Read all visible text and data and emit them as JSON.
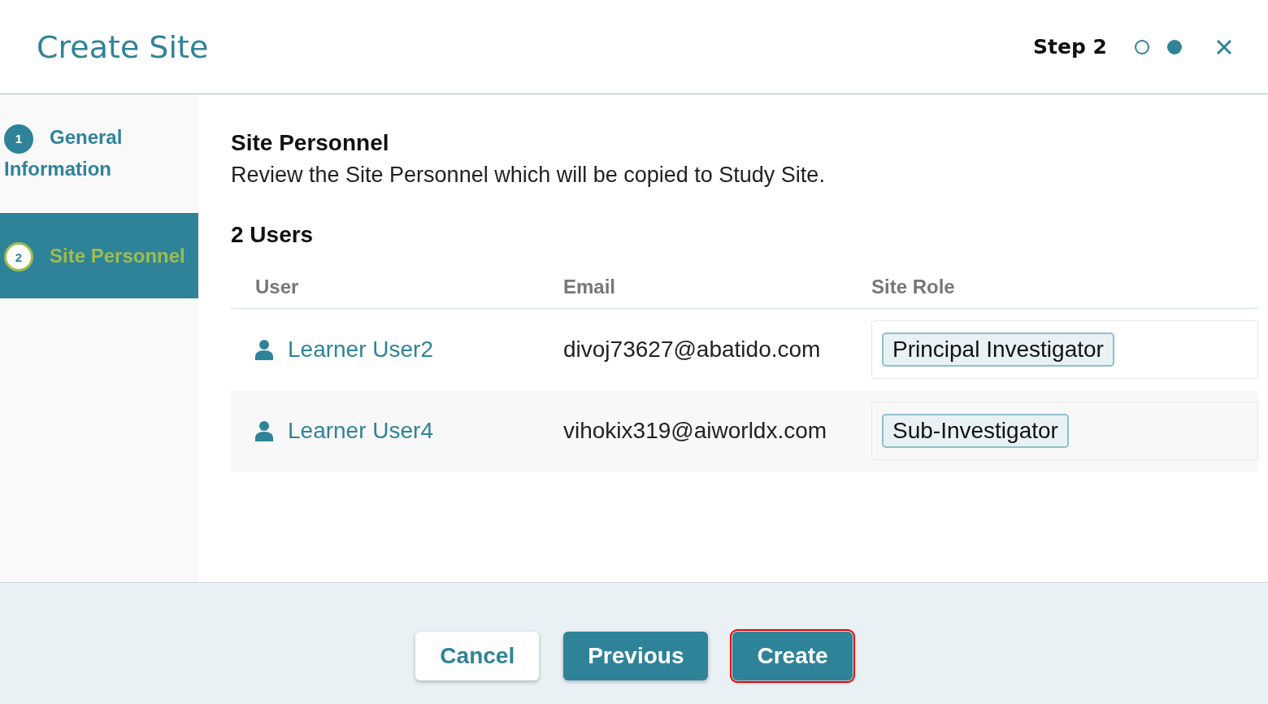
{
  "window": {
    "title": "Create Site",
    "step_label": "Step 2",
    "progress": [
      {
        "selected": false
      },
      {
        "selected": true
      }
    ]
  },
  "steps": [
    {
      "number": "1",
      "label": "General Information",
      "selected": false
    },
    {
      "number": "2",
      "label": "Site Personnel",
      "selected": true
    }
  ],
  "section": {
    "title": "Site Personnel",
    "description": "Review the Site Personnel which will be copied to Study Site.",
    "count": "2 Users"
  },
  "table": {
    "columns": [
      "User",
      "Email",
      "Site Role"
    ],
    "rows": [
      {
        "user": "Learner User2",
        "email": "divoj73627@abatido.com",
        "role": "Principal Investigator"
      },
      {
        "user": "Learner User4",
        "email": "vihokix319@aiworldx.com",
        "role": "Sub-Investigator"
      }
    ]
  },
  "buttons": [
    {
      "label": "Cancel",
      "kind": "secondary",
      "focused": false
    },
    {
      "label": "Previous",
      "kind": "primary",
      "focused": false
    },
    {
      "label": "Create",
      "kind": "primary",
      "focused": true
    }
  ]
}
